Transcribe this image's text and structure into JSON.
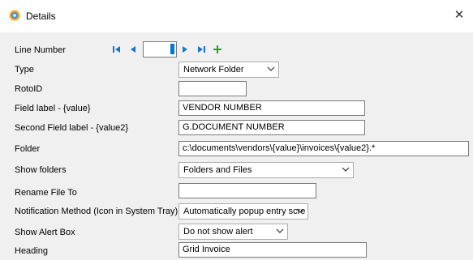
{
  "window": {
    "title": "Details",
    "icon": "gear-icon",
    "close_glyph": "✕"
  },
  "navigator": {
    "label": "Line Number",
    "value": ""
  },
  "fields": {
    "type": {
      "label": "Type",
      "value": "Network Folder"
    },
    "roto_id": {
      "label": "RotoID",
      "value": ""
    },
    "field_label": {
      "label": "Field label - {value}",
      "value": "VENDOR NUMBER"
    },
    "second_field_label": {
      "label": "Second Field label - {value2}",
      "value": "G.DOCUMENT NUMBER"
    },
    "folder": {
      "label": "Folder",
      "value": "c:\\documents\\vendors\\{value}\\invoices\\{value2}.*"
    },
    "show_folders": {
      "label": "Show folders",
      "value": "Folders and Files"
    },
    "rename_file_to": {
      "label": "Rename File To",
      "value": ""
    },
    "notification_method": {
      "label": "Notification Method (Icon in System Tray)",
      "value": "Automatically popup entry scre"
    },
    "show_alert_box": {
      "label": "Show Alert Box",
      "value": "Do not show alert"
    },
    "heading": {
      "label": "Heading",
      "value": "Grid Invoice"
    }
  },
  "colors": {
    "nav_blue": "#1a73c6",
    "add_green": "#2e9e2e",
    "panel_bg": "#f0f0f0",
    "selection": "#0078d7"
  }
}
